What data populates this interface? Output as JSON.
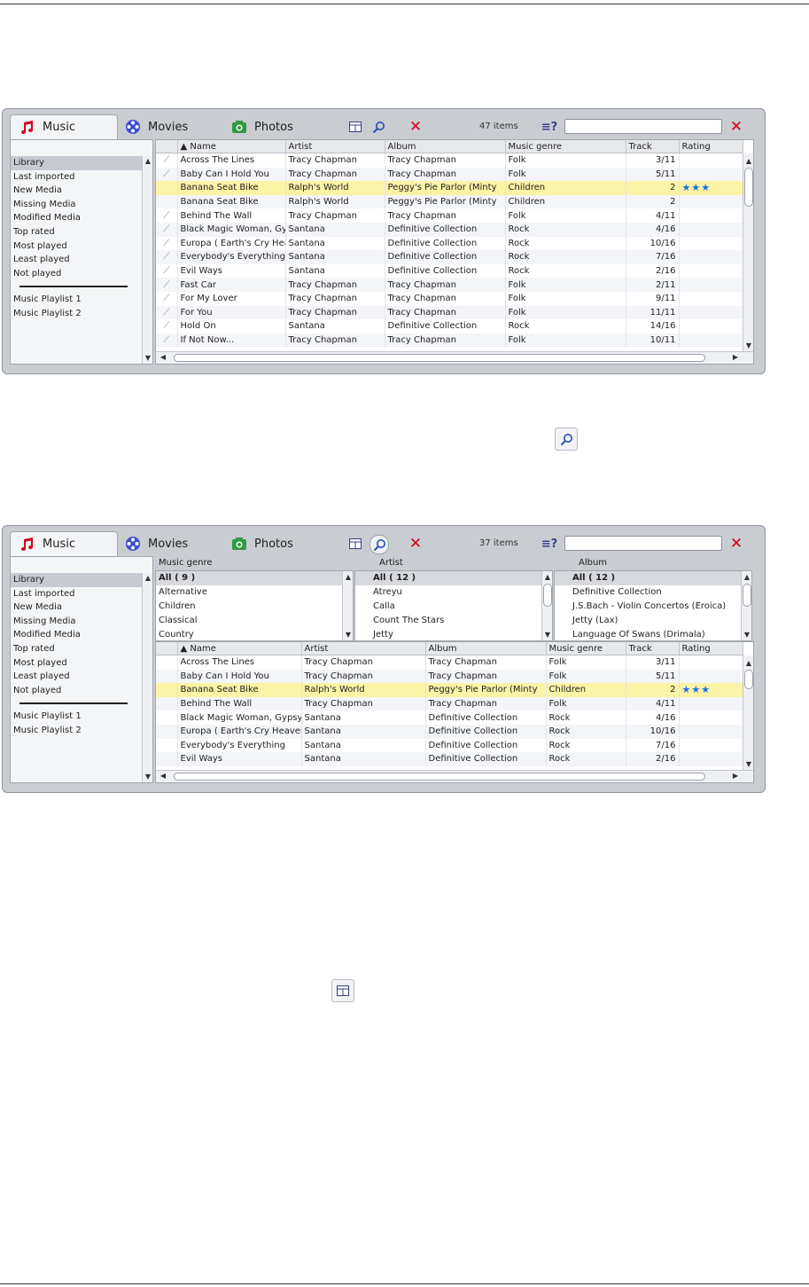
{
  "tabs": {
    "music": "Music",
    "movies": "Movies",
    "photos": "Photos"
  },
  "sidebar": {
    "items": [
      "Library",
      "Last imported",
      "New Media",
      "Missing Media",
      "Modified Media",
      "Top rated",
      "Most played",
      "Least played",
      "Not played"
    ],
    "playlists": [
      "Music Playlist 1",
      "Music Playlist 2"
    ]
  },
  "columns": {
    "name": "▲ Name",
    "artist": "Artist",
    "album": "Album",
    "genre": "Music genre",
    "track": "Track",
    "rating": "Rating"
  },
  "screen1": {
    "count": "47 items",
    "rows": [
      {
        "name": "Across The Lines",
        "artist": "Tracy Chapman",
        "album": "Tracy Chapman",
        "genre": "Folk",
        "track": "3/11",
        "rating": 0
      },
      {
        "name": "Baby Can I Hold You",
        "artist": "Tracy Chapman",
        "album": "Tracy Chapman",
        "genre": "Folk",
        "track": "5/11",
        "rating": 0
      },
      {
        "name": "Banana Seat Bike",
        "artist": "Ralph's World",
        "album": "Peggy's Pie Parlor (Minty",
        "genre": "Children",
        "track": "2",
        "rating": 3
      },
      {
        "name": "Banana Seat Bike",
        "artist": "Ralph's World",
        "album": "Peggy's Pie Parlor (Minty",
        "genre": "Children",
        "track": "2",
        "rating": 0
      },
      {
        "name": "Behind The Wall",
        "artist": "Tracy Chapman",
        "album": "Tracy Chapman",
        "genre": "Folk",
        "track": "4/11",
        "rating": 0
      },
      {
        "name": "Black Magic Woman, Gypsy Queen",
        "artist": "Santana",
        "album": "Definitive Collection",
        "genre": "Rock",
        "track": "4/16",
        "rating": 0
      },
      {
        "name": "Europa ( Earth's Cry Heaven's Smile )",
        "artist": "Santana",
        "album": "Definitive Collection",
        "genre": "Rock",
        "track": "10/16",
        "rating": 0
      },
      {
        "name": "Everybody's Everything",
        "artist": "Santana",
        "album": "Definitive Collection",
        "genre": "Rock",
        "track": "7/16",
        "rating": 0
      },
      {
        "name": "Evil Ways",
        "artist": "Santana",
        "album": "Definitive Collection",
        "genre": "Rock",
        "track": "2/16",
        "rating": 0
      },
      {
        "name": "Fast Car",
        "artist": "Tracy Chapman",
        "album": "Tracy Chapman",
        "genre": "Folk",
        "track": "2/11",
        "rating": 0
      },
      {
        "name": "For My Lover",
        "artist": "Tracy Chapman",
        "album": "Tracy Chapman",
        "genre": "Folk",
        "track": "9/11",
        "rating": 0
      },
      {
        "name": "For You",
        "artist": "Tracy Chapman",
        "album": "Tracy Chapman",
        "genre": "Folk",
        "track": "11/11",
        "rating": 0
      },
      {
        "name": "Hold On",
        "artist": "Santana",
        "album": "Definitive Collection",
        "genre": "Rock",
        "track": "14/16",
        "rating": 0
      },
      {
        "name": "If Not Now...",
        "artist": "Tracy Chapman",
        "album": "Tracy Chapman",
        "genre": "Folk",
        "track": "10/11",
        "rating": 0
      }
    ]
  },
  "screen2": {
    "count": "37 items",
    "filters": [
      {
        "label": "Music genre",
        "items": [
          "All ( 9 )",
          "Alternative",
          "Children",
          "Classical",
          "Country"
        ]
      },
      {
        "label": "Artist",
        "items": [
          "All ( 12 )",
          "Atreyu",
          "Calla",
          "Count The Stars",
          "Jetty"
        ]
      },
      {
        "label": "Album",
        "items": [
          "All ( 12 )",
          "Definitive Collection",
          "J.S.Bach - Violin Concertos (Eroica)",
          "Jetty (Lax)",
          "Language Of Swans (Drimala)"
        ]
      }
    ],
    "rows": [
      {
        "name": "Across The Lines",
        "artist": "Tracy Chapman",
        "album": "Tracy Chapman",
        "genre": "Folk",
        "track": "3/11",
        "rating": 0
      },
      {
        "name": "Baby Can I Hold You",
        "artist": "Tracy Chapman",
        "album": "Tracy Chapman",
        "genre": "Folk",
        "track": "5/11",
        "rating": 0
      },
      {
        "name": "Banana Seat Bike",
        "artist": "Ralph's World",
        "album": "Peggy's Pie Parlor (Minty",
        "genre": "Children",
        "track": "2",
        "rating": 3
      },
      {
        "name": "Behind The Wall",
        "artist": "Tracy Chapman",
        "album": "Tracy Chapman",
        "genre": "Folk",
        "track": "4/11",
        "rating": 0
      },
      {
        "name": "Black Magic Woman, Gypsy Queen",
        "artist": "Santana",
        "album": "Definitive Collection",
        "genre": "Rock",
        "track": "4/16",
        "rating": 0
      },
      {
        "name": "Europa ( Earth's Cry Heaven's Smile )",
        "artist": "Santana",
        "album": "Definitive Collection",
        "genre": "Rock",
        "track": "10/16",
        "rating": 0
      },
      {
        "name": "Everybody's Everything",
        "artist": "Santana",
        "album": "Definitive Collection",
        "genre": "Rock",
        "track": "7/16",
        "rating": 0
      },
      {
        "name": "Evil Ways",
        "artist": "Santana",
        "album": "Definitive Collection",
        "genre": "Rock",
        "track": "2/16",
        "rating": 0
      }
    ]
  },
  "icons": {
    "music": "music-note-icon",
    "movies": "film-reel-icon",
    "photos": "camera-icon",
    "view": "view-layout-icon",
    "search": "search-icon",
    "close": "close-icon",
    "filter": "filter-help-icon"
  },
  "colors": {
    "highlight_row": "#fbf3a6",
    "rating_star": "#1d6fe0",
    "close_red": "#d0021b"
  }
}
